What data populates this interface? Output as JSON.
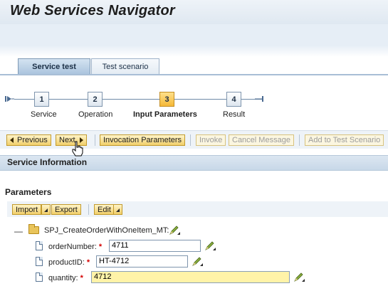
{
  "app": {
    "title": "Web Services Navigator"
  },
  "tabs": [
    {
      "label": "Service test",
      "active": true
    },
    {
      "label": "Test scenario",
      "active": false
    }
  ],
  "roadmap": {
    "steps": [
      {
        "number": "1",
        "label": "Service",
        "active": false
      },
      {
        "number": "2",
        "label": "Operation",
        "active": false
      },
      {
        "number": "3",
        "label": "Input Parameters",
        "active": true
      },
      {
        "number": "4",
        "label": "Result",
        "active": false
      }
    ]
  },
  "toolbar": {
    "previous": "Previous",
    "next": "Next",
    "invocation_parameters": "Invocation Parameters",
    "invoke": "Invoke",
    "cancel_message": "Cancel Message",
    "add_to_test_scenario": "Add to Test Scenario"
  },
  "service_info": {
    "title": "Service Information"
  },
  "parameters": {
    "title": "Parameters",
    "toolbar": {
      "import": "Import",
      "export": "Export",
      "edit": "Edit"
    },
    "root_node": "SPJ_CreateOrderWithOneItem_MT:",
    "fields": [
      {
        "label": "orderNumber:",
        "required_mark": "*",
        "value": "4711"
      },
      {
        "label": "productID:",
        "required_mark": "*",
        "value": "HT-4712"
      },
      {
        "label": "quantity:",
        "required_mark": "*",
        "value": "4712"
      }
    ]
  },
  "colors": {
    "accent_button": "#f1cf6a",
    "header_blue": "#e6eef6",
    "active_step": "#f5b838",
    "focused_input": "#fff3a8",
    "required": "#d40000"
  }
}
